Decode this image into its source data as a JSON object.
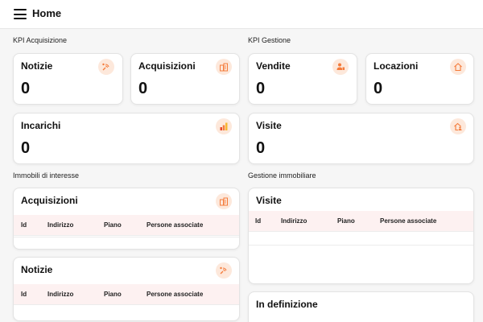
{
  "header": {
    "title": "Home",
    "menu_icon": "hamburger-menu-icon"
  },
  "sections": {
    "kpi_acquisizione": "KPI Acquisizione",
    "kpi_gestione": "KPI Gestione",
    "immobili_interesse": "Immobili di interesse",
    "gestione_immobiliare": "Gestione immobiliare"
  },
  "kpi": {
    "notizie": {
      "label": "Notizie",
      "value": "0",
      "icon": "signal-waves-icon"
    },
    "acquisizioni": {
      "label": "Acquisizioni",
      "value": "0",
      "icon": "buildings-icon"
    },
    "vendite": {
      "label": "Vendite",
      "value": "0",
      "icon": "user-tag-icon"
    },
    "locazioni": {
      "label": "Locazioni",
      "value": "0",
      "icon": "house-outline-icon"
    },
    "incarichi": {
      "label": "Incarichi",
      "value": "0",
      "icon": "bar-chart-icon"
    },
    "visite": {
      "label": "Visite",
      "value": "0",
      "icon": "house-person-icon"
    }
  },
  "tables": {
    "acquisizioni": {
      "title": "Acquisizioni",
      "icon": "buildings-icon",
      "columns": [
        "Id",
        "Indirizzo",
        "Piano",
        "Persone associate"
      ]
    },
    "notizie": {
      "title": "Notizie",
      "icon": "signal-waves-icon",
      "columns": [
        "Id",
        "Indirizzo",
        "Piano",
        "Persone associate"
      ]
    },
    "visite": {
      "title": "Visite",
      "columns": [
        "Id",
        "Indirizzo",
        "Piano",
        "Persone associate"
      ]
    },
    "in_definizione": {
      "title": "In definizione"
    }
  },
  "colors": {
    "accent": "#f47b3b",
    "icon_bg": "#fde8db",
    "table_header_bg": "#fdf1f1",
    "page_bg": "#f6f6f6"
  }
}
